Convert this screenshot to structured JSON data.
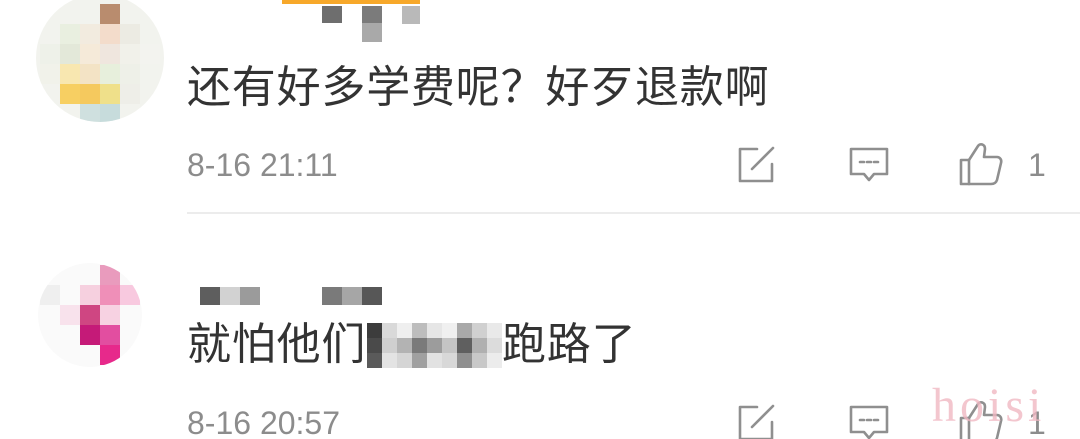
{
  "comments": [
    {
      "text": "还有好多学费呢？好歹退款啊",
      "timestamp": "8-16 21:11",
      "like_count": "1",
      "icons": {
        "share": "share-icon",
        "reply": "comment-icon",
        "like": "thumbs-up-icon"
      }
    },
    {
      "text_before": "就怕他们",
      "text_after": "跑路了",
      "timestamp": "8-16 20:57",
      "like_count": "1",
      "icons": {
        "share": "share-icon",
        "reply": "comment-icon",
        "like": "thumbs-up-icon"
      }
    }
  ],
  "watermark": "hoisi",
  "colors": {
    "text": "#333333",
    "meta": "#8c8c8c",
    "icon": "#8f8f8f",
    "divider": "#ececec",
    "accent": "#f7a82a",
    "watermark": "#f1b8c3"
  }
}
